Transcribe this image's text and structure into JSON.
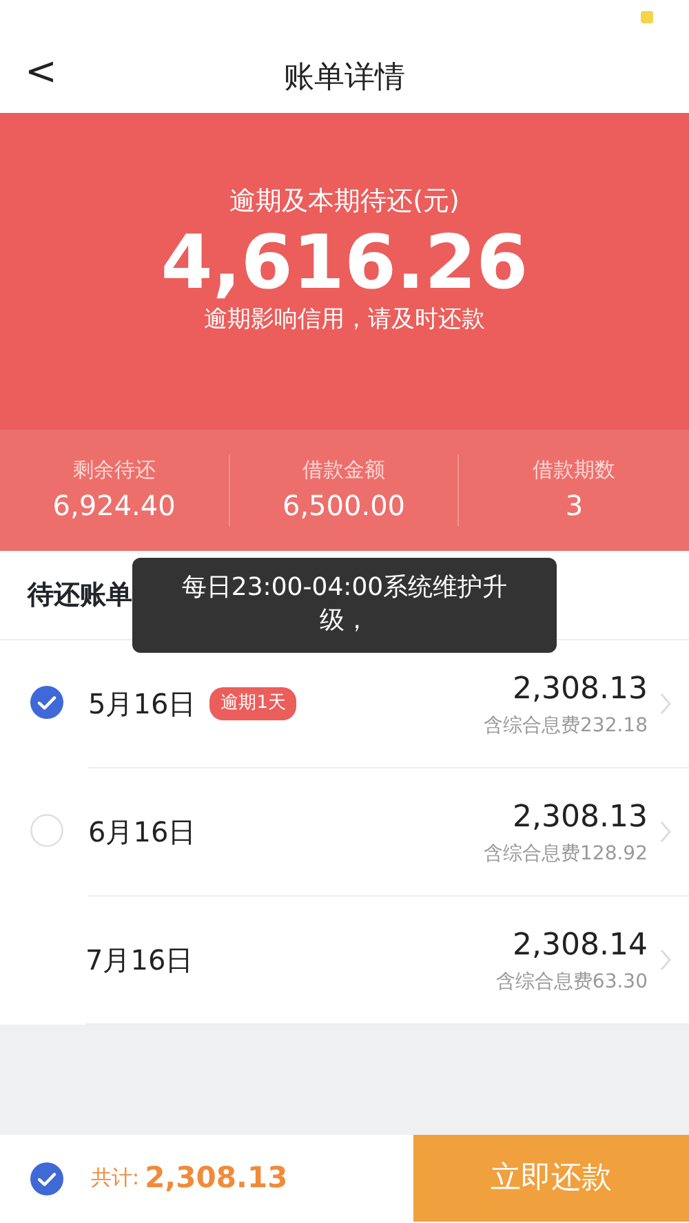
{
  "nav": {
    "back": "<",
    "title": "账单详情"
  },
  "summary": {
    "label": "逾期及本期待还(元)",
    "amount": "4,616.26",
    "note": "逾期影响信用，请及时还款"
  },
  "stats": [
    {
      "label": "剩余待还",
      "value": "6,924.40"
    },
    {
      "label": "借款金额",
      "value": "6,500.00"
    },
    {
      "label": "借款期数",
      "value": "3"
    }
  ],
  "section_title": "待还账单",
  "bills": [
    {
      "kind": "checkbox",
      "checked": true,
      "date": "5月16日",
      "badge": "逾期1天",
      "amount": "2,308.13",
      "fee": "含综合息费232.18"
    },
    {
      "kind": "checkbox",
      "checked": false,
      "date": "6月16日",
      "amount": "2,308.13",
      "fee": "含综合息费128.92"
    },
    {
      "kind": "plain",
      "date": "7月16日",
      "amount": "2,308.14",
      "fee": "含综合息费63.30"
    }
  ],
  "toast": "每日23:00-04:00系统维护升级，",
  "footer": {
    "checked": true,
    "total_label": "共计:",
    "total": "2,308.13",
    "button": "立即还款"
  }
}
